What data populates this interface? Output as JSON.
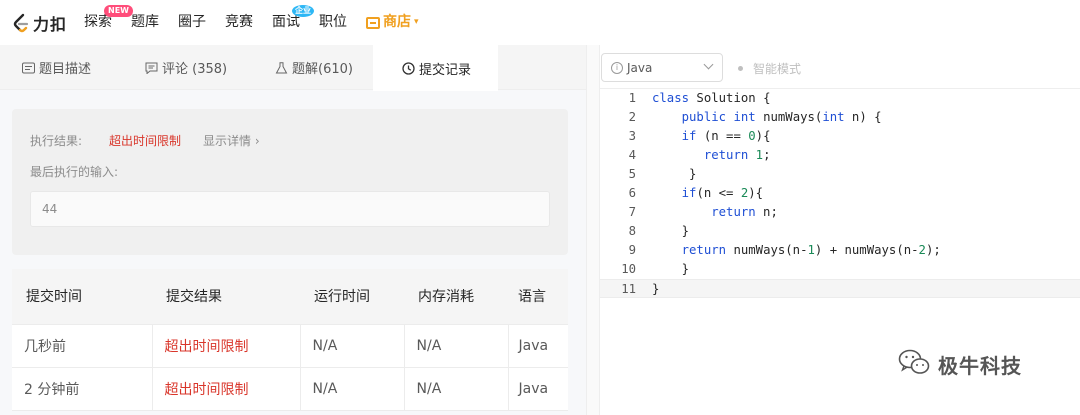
{
  "brand": {
    "name": "力扣"
  },
  "nav": {
    "items": [
      {
        "label": "探索",
        "badge": "NEW"
      },
      {
        "label": "题库"
      },
      {
        "label": "圈子"
      },
      {
        "label": "竞赛"
      },
      {
        "label": "面试",
        "badge": "企业"
      },
      {
        "label": "职位"
      }
    ],
    "store": "商店"
  },
  "tabs": [
    {
      "label": "题目描述"
    },
    {
      "label": "评论 (358)"
    },
    {
      "label": "题解(610)"
    },
    {
      "label": "提交记录"
    }
  ],
  "result": {
    "label": "执行结果:",
    "status": "超出时间限制",
    "detail": "显示详情 ›",
    "last_input_label": "最后执行的输入:",
    "last_input_value": "44"
  },
  "table": {
    "headers": [
      "提交时间",
      "提交结果",
      "运行时间",
      "内存消耗",
      "语言"
    ],
    "rows": [
      [
        "几秒前",
        "超出时间限制",
        "N/A",
        "N/A",
        "Java"
      ],
      [
        "2 分钟前",
        "超出时间限制",
        "N/A",
        "N/A",
        "Java"
      ]
    ]
  },
  "editor": {
    "language": "Java",
    "smart_mode": "智能模式",
    "line_numbers": [
      "1",
      "2",
      "3",
      "4",
      "5",
      "6",
      "7",
      "8",
      "9",
      "10",
      "11"
    ]
  },
  "watermark": "极牛科技",
  "colors": {
    "error": "#d9362b",
    "store": "#f0a020",
    "keyword": "#1f4fd4"
  }
}
